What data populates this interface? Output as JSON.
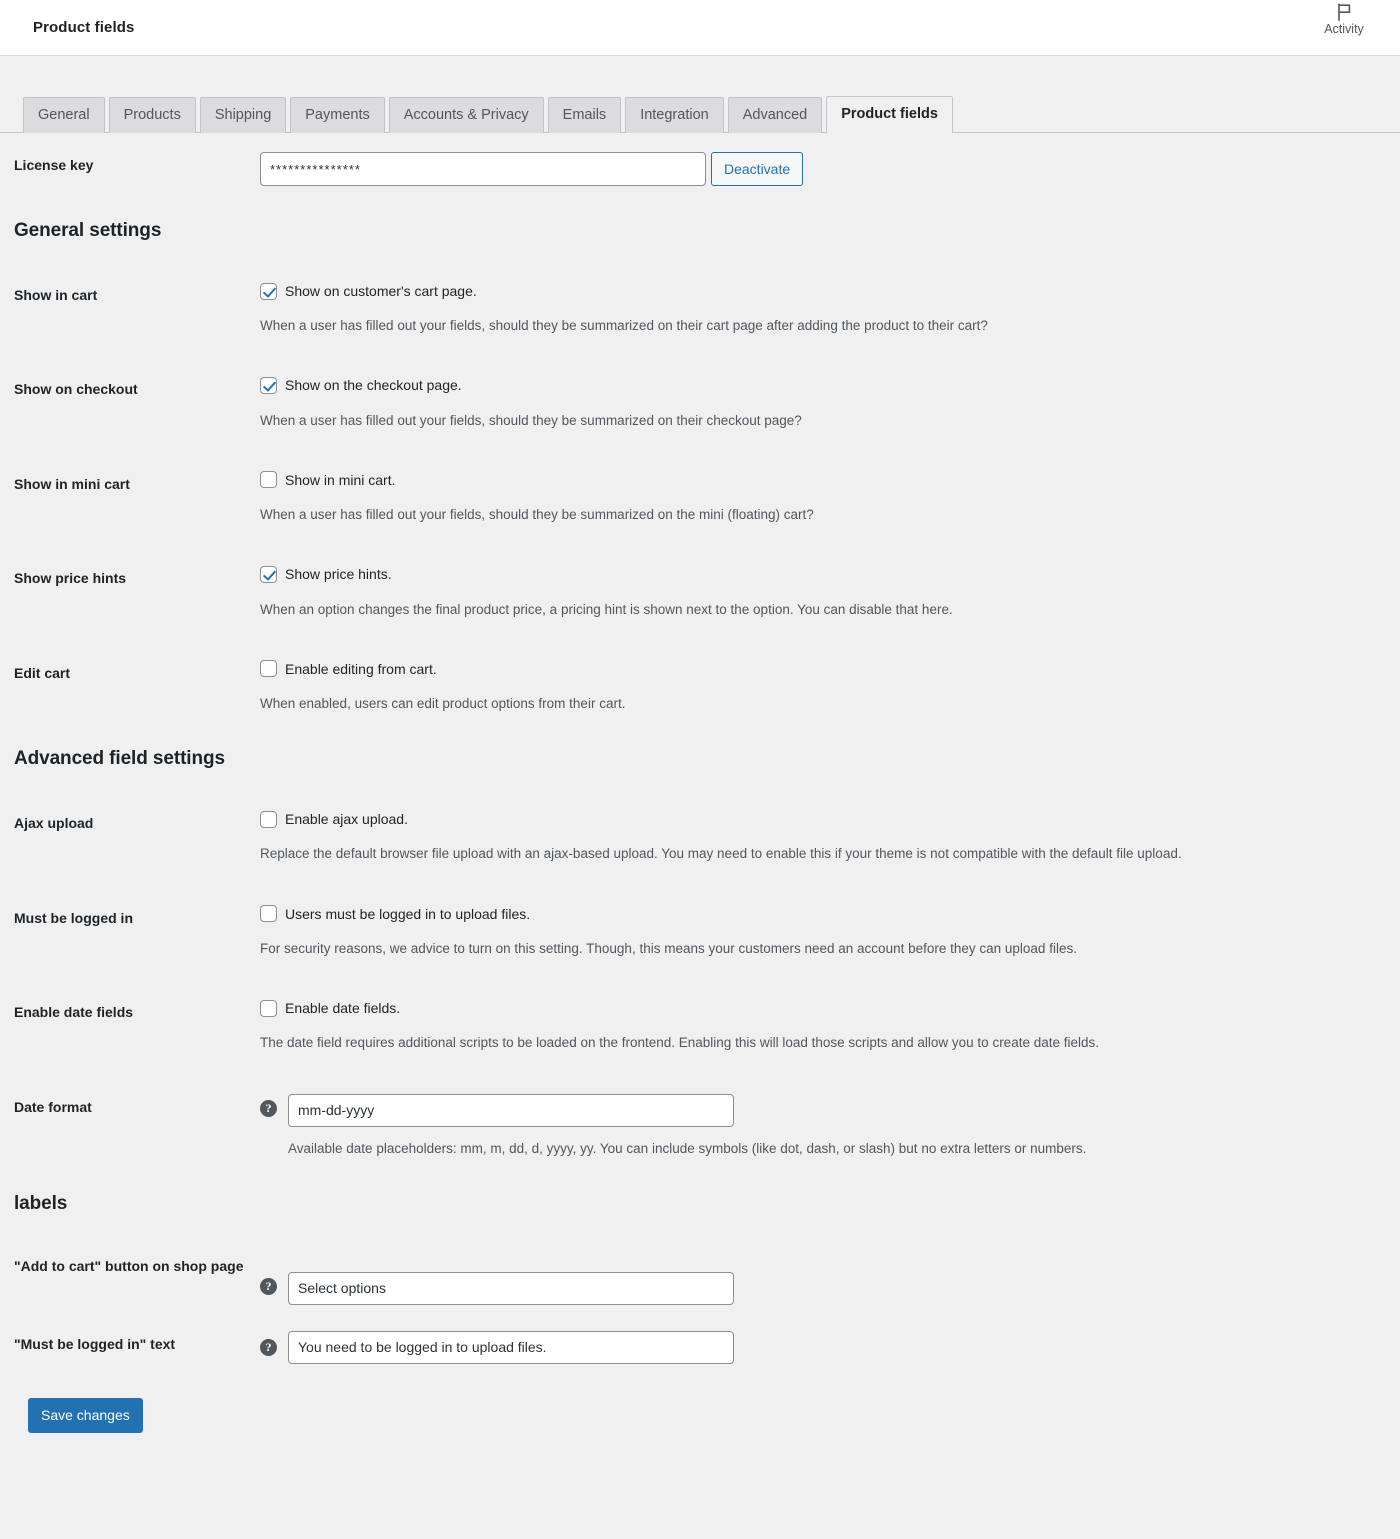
{
  "header": {
    "title": "Product fields",
    "activity_label": "Activity",
    "activity_icon": "flag-icon"
  },
  "tabs": [
    {
      "label": "General",
      "active": false
    },
    {
      "label": "Products",
      "active": false
    },
    {
      "label": "Shipping",
      "active": false
    },
    {
      "label": "Payments",
      "active": false
    },
    {
      "label": "Accounts & Privacy",
      "active": false
    },
    {
      "label": "Emails",
      "active": false
    },
    {
      "label": "Integration",
      "active": false
    },
    {
      "label": "Advanced",
      "active": false
    },
    {
      "label": "Product fields",
      "active": true
    }
  ],
  "license": {
    "label": "License key",
    "value": "***************",
    "button": "Deactivate"
  },
  "sections": {
    "general": "General settings",
    "advanced": "Advanced field settings",
    "labels": "labels"
  },
  "general_settings": [
    {
      "label": "Show in cart",
      "checkbox_label": "Show on customer's cart page.",
      "checked": true,
      "description": "When a user has filled out your fields, should they be summarized on their cart page after adding the product to their cart?"
    },
    {
      "label": "Show on checkout",
      "checkbox_label": "Show on the checkout page.",
      "checked": true,
      "description": "When a user has filled out your fields, should they be summarized on their checkout page?"
    },
    {
      "label": "Show in mini cart",
      "checkbox_label": "Show in mini cart.",
      "checked": false,
      "description": "When a user has filled out your fields, should they be summarized on the mini (floating) cart?"
    },
    {
      "label": "Show price hints",
      "checkbox_label": "Show price hints.",
      "checked": true,
      "description": "When an option changes the final product price, a pricing hint is shown next to the option. You can disable that here."
    },
    {
      "label": "Edit cart",
      "checkbox_label": "Enable editing from cart.",
      "checked": false,
      "description": "When enabled, users can edit product options from their cart."
    }
  ],
  "advanced_settings": [
    {
      "label": "Ajax upload",
      "checkbox_label": "Enable ajax upload.",
      "checked": false,
      "description": "Replace the default browser file upload with an ajax-based upload. You may need to enable this if your theme is not compatible with the default file upload."
    },
    {
      "label": "Must be logged in",
      "checkbox_label": "Users must be logged in to upload files.",
      "checked": false,
      "description": "For security reasons, we advice to turn on this setting. Though, this means your customers need an account before they can upload files."
    },
    {
      "label": "Enable date fields",
      "checkbox_label": "Enable date fields.",
      "checked": false,
      "description": "The date field requires additional scripts to be loaded on the frontend. Enabling this will load those scripts and allow you to create date fields."
    }
  ],
  "date_format": {
    "label": "Date format",
    "value": "mm-dd-yyyy",
    "description": "Available date placeholders: mm, m, dd, d, yyyy, yy. You can include symbols (like dot, dash, or slash) but no extra letters or numbers.",
    "help_icon": "help-icon"
  },
  "label_settings": [
    {
      "label": "\"Add to cart\" button on shop page",
      "value": "Select options",
      "help_icon": "help-icon"
    },
    {
      "label": "\"Must be logged in\" text",
      "value": "You need to be logged in to upload files.",
      "help_icon": "help-icon"
    }
  ],
  "save": {
    "label": "Save changes"
  },
  "colors": {
    "accent": "#2271b1",
    "page_bg": "#f0f0f1",
    "tab_bg": "#dcdcde",
    "border": "#c3c4c7",
    "text": "#1d2327",
    "muted": "#50575e"
  }
}
